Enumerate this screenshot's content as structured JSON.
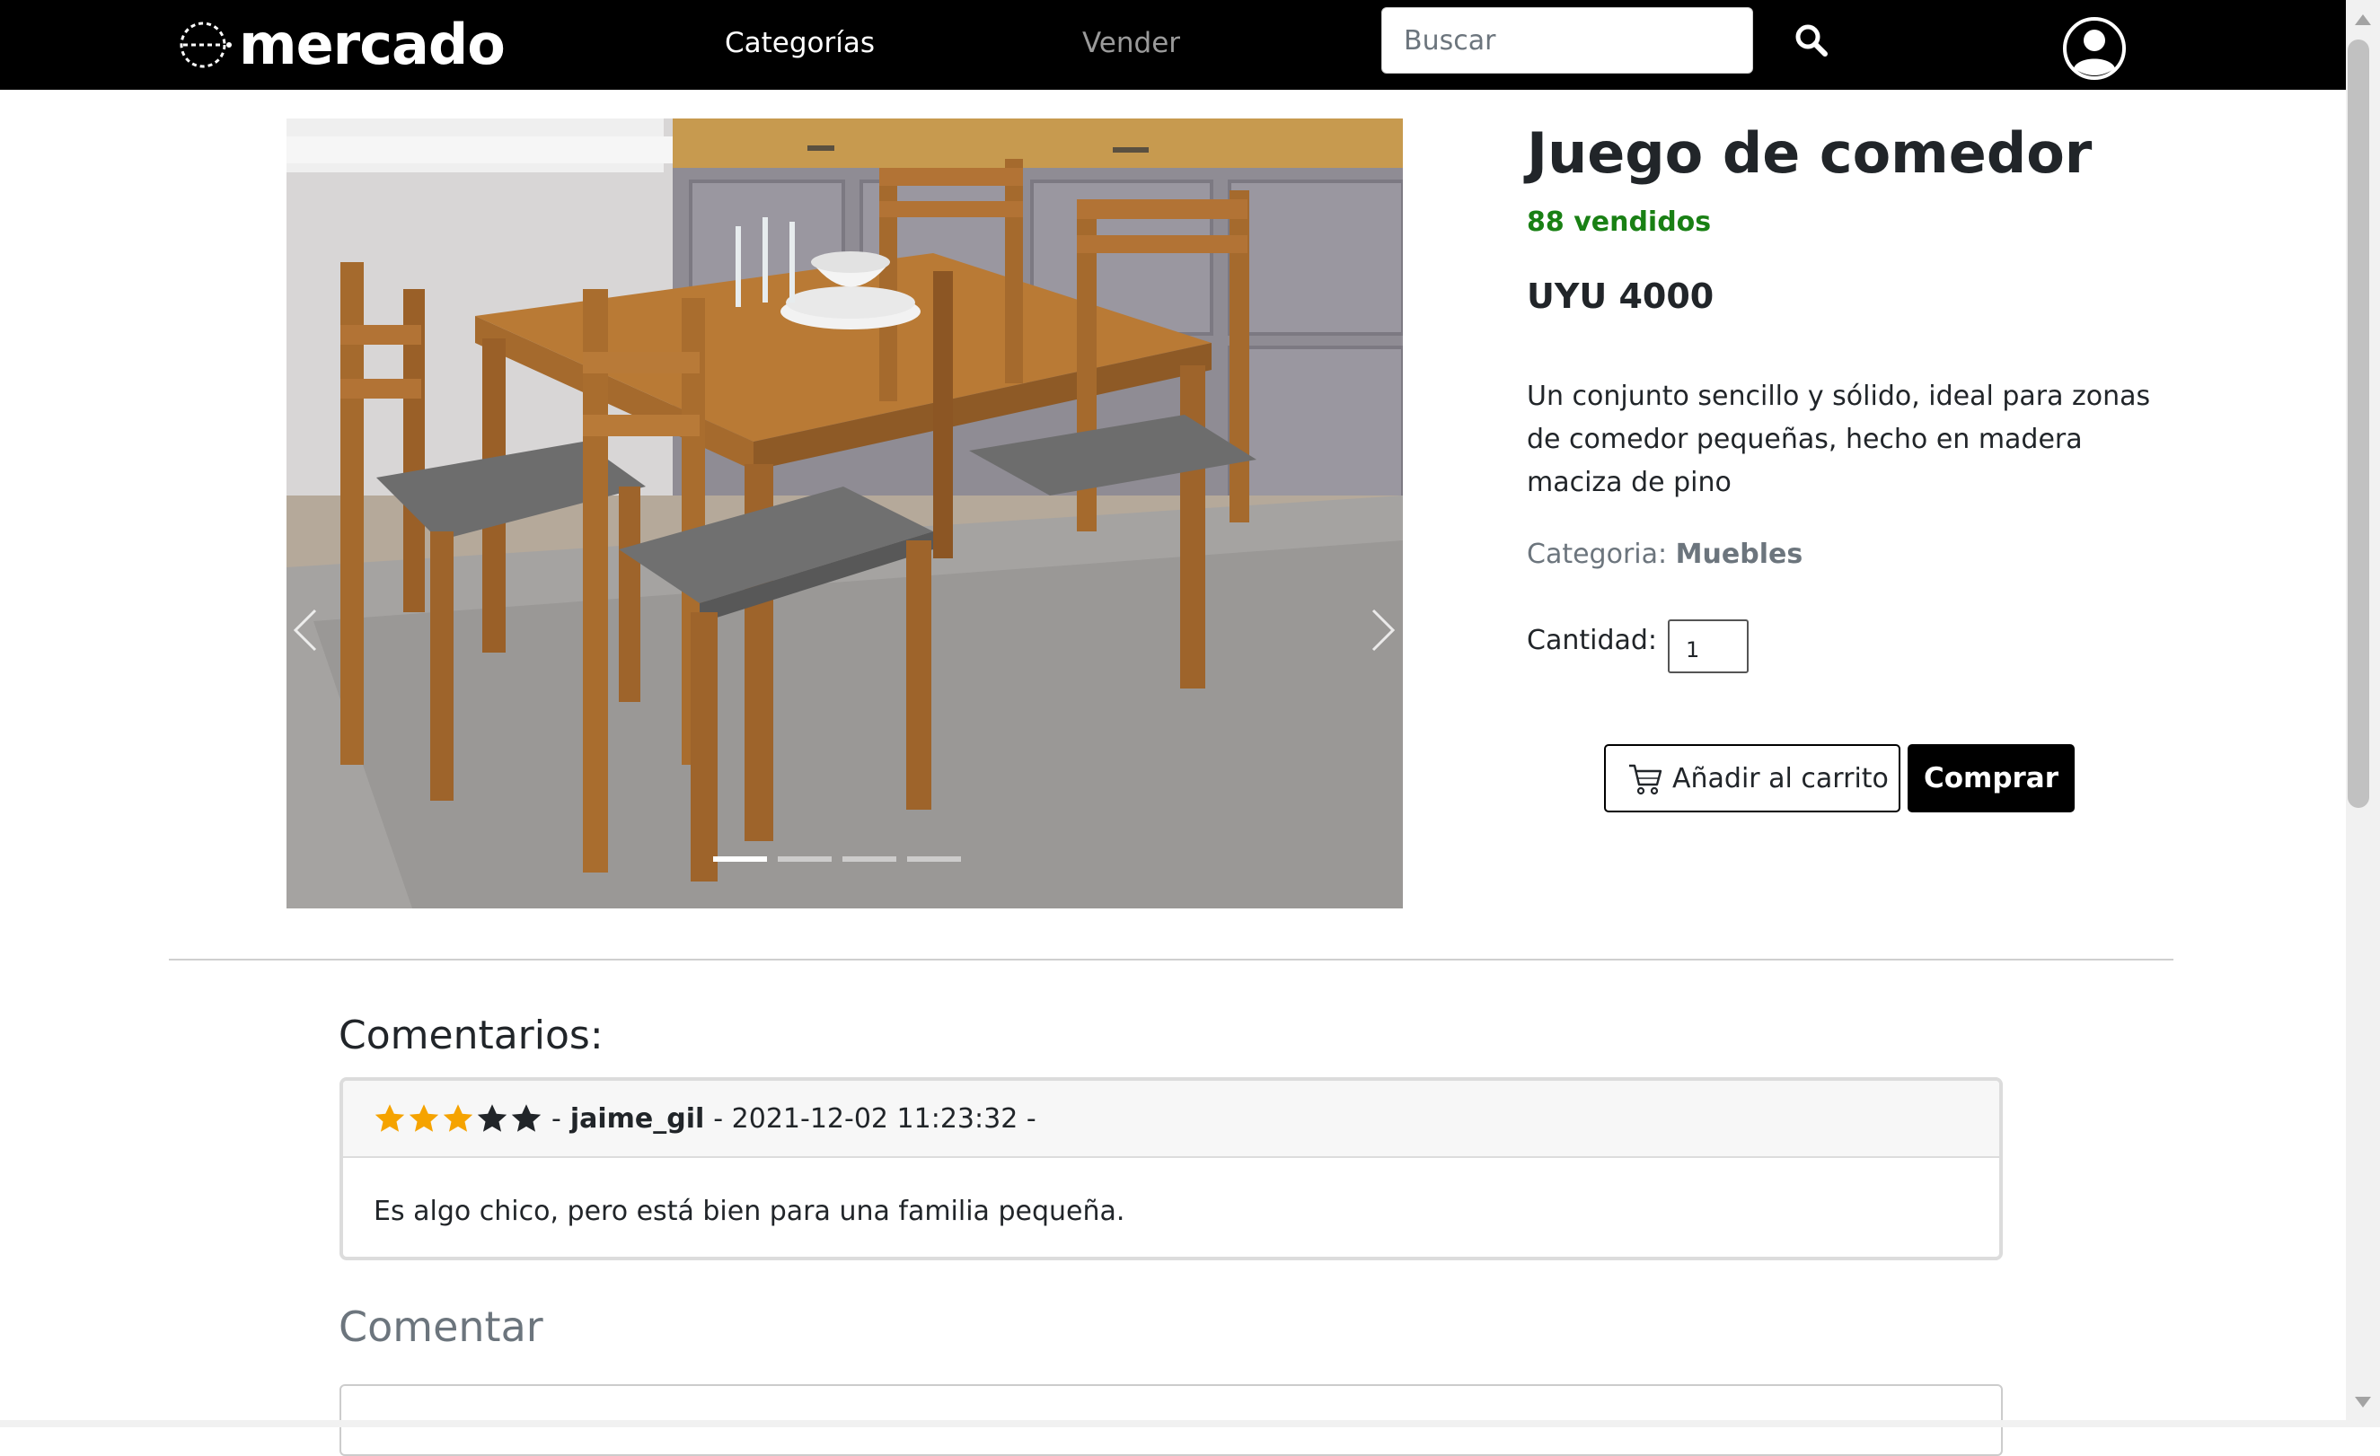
{
  "nav": {
    "brand": "mercado",
    "categories": "Categorías",
    "sell": "Vender",
    "search_placeholder": "Buscar",
    "icons": [
      "brand-logo-icon",
      "search-icon",
      "user-icon"
    ]
  },
  "product": {
    "title": "Juego de comedor",
    "sold": "88 vendidos",
    "price": "UYU 4000",
    "description": "Un conjunto sencillo y sólido, ideal para zonas de comedor pequeñas, hecho en madera maciza de pino",
    "category_label": "Categoria:",
    "category_value": "Muebles",
    "quantity_label": "Cantidad:",
    "quantity_value": "1",
    "add_to_cart": "Añadir al carrito",
    "buy": "Comprar",
    "carousel": {
      "slides": 4,
      "active_slide": 1
    }
  },
  "comments": {
    "heading": "Comentarios:",
    "items": [
      {
        "rating": 3,
        "max_rating": 5,
        "sep1": "-",
        "user": "jaime_gil",
        "datetime": "- 2021-12-02 11:23:32 -",
        "text": "Es algo chico, pero está bien para una familia pequeña."
      }
    ],
    "form_heading": "Comentar"
  },
  "colors": {
    "navbar": "#000000",
    "sold_green": "#198014",
    "star_filled": "#f5a300",
    "star_empty": "#212529"
  }
}
